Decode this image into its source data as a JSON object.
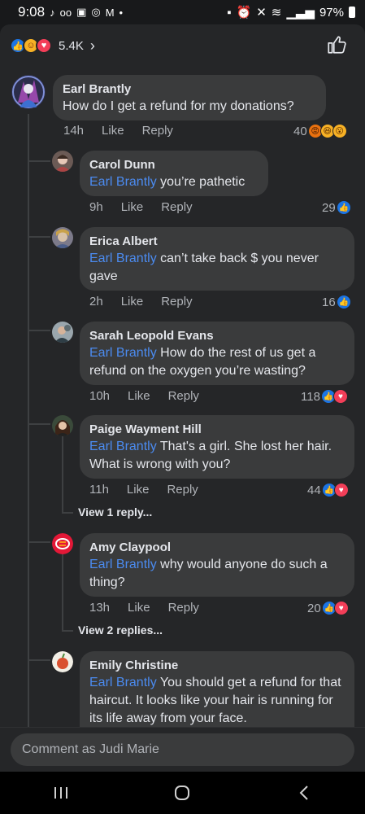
{
  "status_bar": {
    "time": "9:08",
    "battery": "97%"
  },
  "reactions": {
    "count": "5.4K"
  },
  "comments": [
    {
      "name": "Earl Brantly",
      "text": "How do I get a refund for my donations?",
      "time": "14h",
      "like_label": "Like",
      "reply_label": "Reply",
      "reaction_count": "40"
    },
    {
      "name": "Carol Dunn",
      "mention": "Earl Brantly",
      "text": " you’re pathetic",
      "time": "9h",
      "like_label": "Like",
      "reply_label": "Reply",
      "reaction_count": "29"
    },
    {
      "name": "Erica Albert",
      "mention": "Earl Brantly",
      "text": " can’t take back $ you never gave",
      "time": "2h",
      "like_label": "Like",
      "reply_label": "Reply",
      "reaction_count": "16"
    },
    {
      "name": "Sarah Leopold Evans",
      "mention": "Earl Brantly",
      "text": " How do the rest of us get a refund on the oxygen you’re wasting?",
      "time": "10h",
      "like_label": "Like",
      "reply_label": "Reply",
      "reaction_count": "118"
    },
    {
      "name": "Paige Wayment Hill",
      "mention": "Earl Brantly",
      "text": " That's a girl. She lost her hair. What is wrong with you?",
      "time": "11h",
      "like_label": "Like",
      "reply_label": "Reply",
      "reaction_count": "44",
      "view_replies": "View 1 reply..."
    },
    {
      "name": "Amy Claypool",
      "mention": "Earl Brantly",
      "text": " why would anyone do such a thing?",
      "time": "13h",
      "like_label": "Like",
      "reply_label": "Reply",
      "reaction_count": "20",
      "view_replies": "View 2 replies..."
    },
    {
      "name": "Emily Christine",
      "mention": "Earl Brantly",
      "text": " You should get a refund for that haircut. It looks like your hair is running for its life away from your face."
    }
  ],
  "composer": {
    "placeholder": "Comment as Judi Marie"
  },
  "colors": {
    "background": "#18191b",
    "panel": "#252628",
    "bubble": "#3a3b3c",
    "mention": "#4b8bf0",
    "like_blue": "#1b74e4",
    "love_red": "#f33e58"
  }
}
